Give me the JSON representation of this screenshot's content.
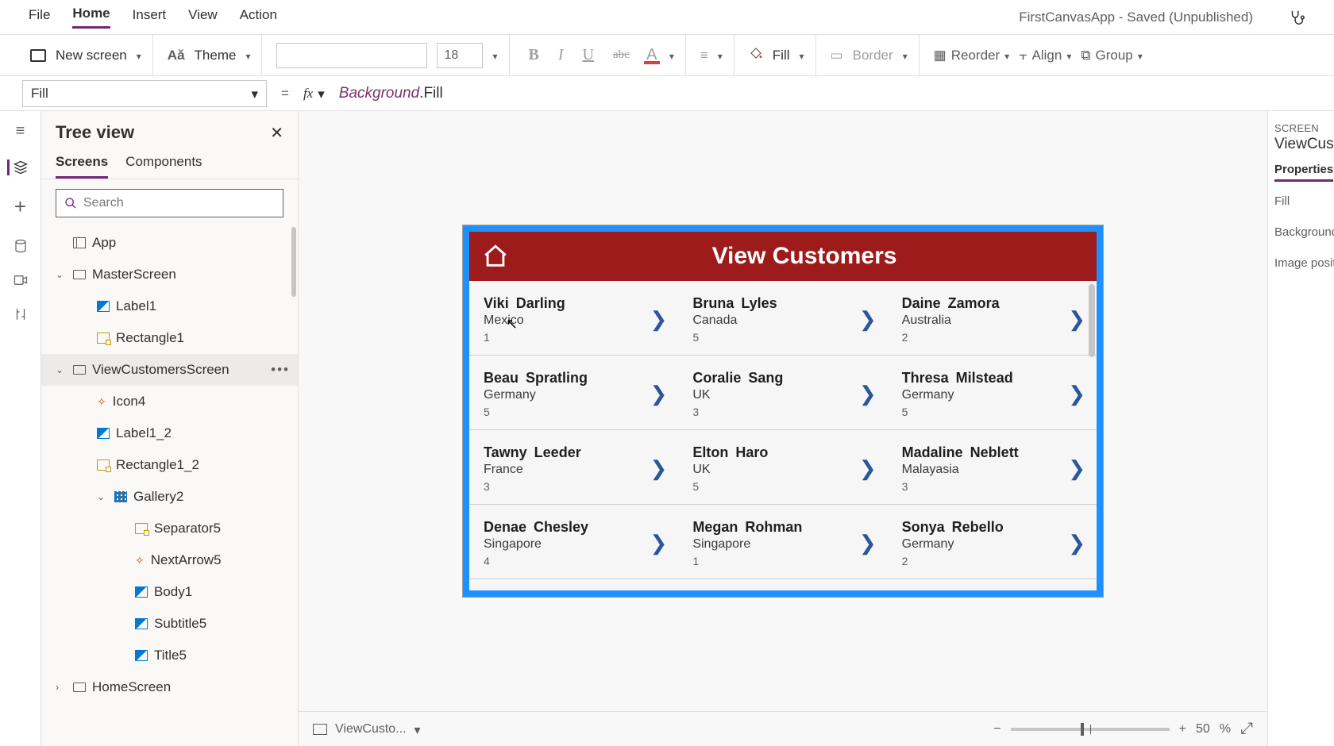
{
  "menubar": {
    "items": [
      "File",
      "Home",
      "Insert",
      "View",
      "Action"
    ],
    "active_index": 1,
    "app_title": "FirstCanvasApp - Saved (Unpublished)"
  },
  "ribbon": {
    "new_screen": "New screen",
    "theme": "Theme",
    "font_size": "18",
    "fill": "Fill",
    "border": "Border",
    "reorder": "Reorder",
    "align": "Align",
    "group": "Group"
  },
  "formula_bar": {
    "property": "Fill",
    "formula_token1": "Background",
    "formula_token2": ".Fill"
  },
  "tree_panel": {
    "title": "Tree view",
    "tabs": [
      "Screens",
      "Components"
    ],
    "active_tab": 0,
    "search_placeholder": "Search",
    "nodes": {
      "app": "App",
      "master": "MasterScreen",
      "label1": "Label1",
      "rect1": "Rectangle1",
      "view": "ViewCustomersScreen",
      "icon4": "Icon4",
      "label12": "Label1_2",
      "rect12": "Rectangle1_2",
      "gallery2": "Gallery2",
      "sep5": "Separator5",
      "next5": "NextArrow5",
      "body1": "Body1",
      "sub5": "Subtitle5",
      "title5": "Title5",
      "home": "HomeScreen"
    }
  },
  "app_screen": {
    "header_title": "View Customers",
    "customers": [
      {
        "name": "Viki  Darling",
        "country": "Mexico",
        "num": "1"
      },
      {
        "name": "Bruna  Lyles",
        "country": "Canada",
        "num": "5"
      },
      {
        "name": "Daine  Zamora",
        "country": "Australia",
        "num": "2"
      },
      {
        "name": "Beau  Spratling",
        "country": "Germany",
        "num": "5"
      },
      {
        "name": "Coralie  Sang",
        "country": "UK",
        "num": "3"
      },
      {
        "name": "Thresa  Milstead",
        "country": "Germany",
        "num": "5"
      },
      {
        "name": "Tawny  Leeder",
        "country": "France",
        "num": "3"
      },
      {
        "name": "Elton  Haro",
        "country": "UK",
        "num": "5"
      },
      {
        "name": "Madaline  Neblett",
        "country": "Malayasia",
        "num": "3"
      },
      {
        "name": "Denae  Chesley",
        "country": "Singapore",
        "num": "4"
      },
      {
        "name": "Megan  Rohman",
        "country": "Singapore",
        "num": "1"
      },
      {
        "name": "Sonya  Rebello",
        "country": "Germany",
        "num": "2"
      }
    ]
  },
  "canvas_status": {
    "breadcrumb": "ViewCusto...",
    "zoom": "50",
    "zoom_unit": "%"
  },
  "properties_panel": {
    "section": "SCREEN",
    "name": "ViewCusto",
    "tab": "Properties",
    "rows": [
      "Fill",
      "Background",
      "Image posit"
    ]
  }
}
